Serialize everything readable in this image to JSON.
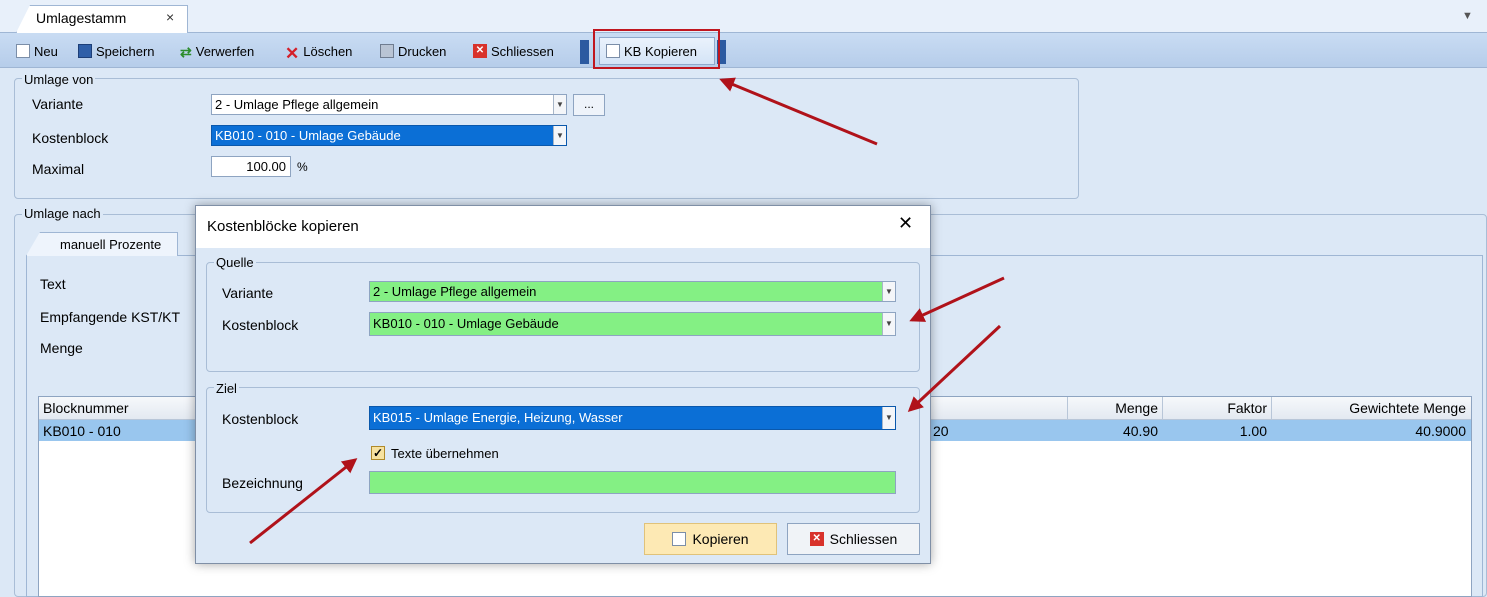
{
  "tab": {
    "title": "Umlagestamm",
    "close": "×",
    "menu": "▼"
  },
  "toolbar": {
    "new": "Neu",
    "save": "Speichern",
    "revert": "Verwerfen",
    "delete": "Löschen",
    "print": "Drucken",
    "close": "Schliessen",
    "kb_copy": "KB Kopieren"
  },
  "umlage_von": {
    "title": "Umlage von",
    "variante_label": "Variante",
    "variante_value": "2 - Umlage Pflege allgemein",
    "kostenblock_label": "Kostenblock",
    "kostenblock_value": "KB010 - 010 - Umlage Gebäude",
    "maximal_label": "Maximal",
    "maximal_value": "100.00",
    "maximal_unit": "%",
    "dots": "..."
  },
  "umlage_nach": {
    "title": "Umlage nach",
    "tab_label": "manuell Prozente",
    "text_label": "Text",
    "empfangende_label": "Empfangende KST/KT",
    "menge_label": "Menge"
  },
  "grid": {
    "columns": {
      "blocknummer": "Blocknummer",
      "menge": "Menge",
      "faktor": "Faktor",
      "gewichtete_menge": "Gewichtete Menge"
    },
    "row": {
      "blocknummer": "KB010 - 010",
      "hidden_tail": "20",
      "menge": "40.90",
      "faktor": "1.00",
      "gewichtete_menge": "40.9000"
    }
  },
  "dialog": {
    "title": "Kostenblöcke kopieren",
    "close": "✕",
    "quelle": {
      "title": "Quelle",
      "variante_label": "Variante",
      "variante_value": "2 - Umlage Pflege allgemein",
      "kostenblock_label": "Kostenblock",
      "kostenblock_value": "KB010 - 010 - Umlage Gebäude"
    },
    "ziel": {
      "title": "Ziel",
      "kostenblock_label": "Kostenblock",
      "kostenblock_value": "KB015 - Umlage Energie, Heizung, Wasser",
      "texte_label": "Texte übernehmen",
      "texte_checked": true,
      "bezeichnung_label": "Bezeichnung",
      "bezeichnung_value": ""
    },
    "btn_kopieren": "Kopieren",
    "btn_schliessen": "Schliessen"
  },
  "colors": {
    "background": "#dce8f6",
    "selection": "#0b6fd6",
    "field_green": "#84f084",
    "row_selected": "#99c6ee",
    "annotation_red": "#c0161f"
  }
}
